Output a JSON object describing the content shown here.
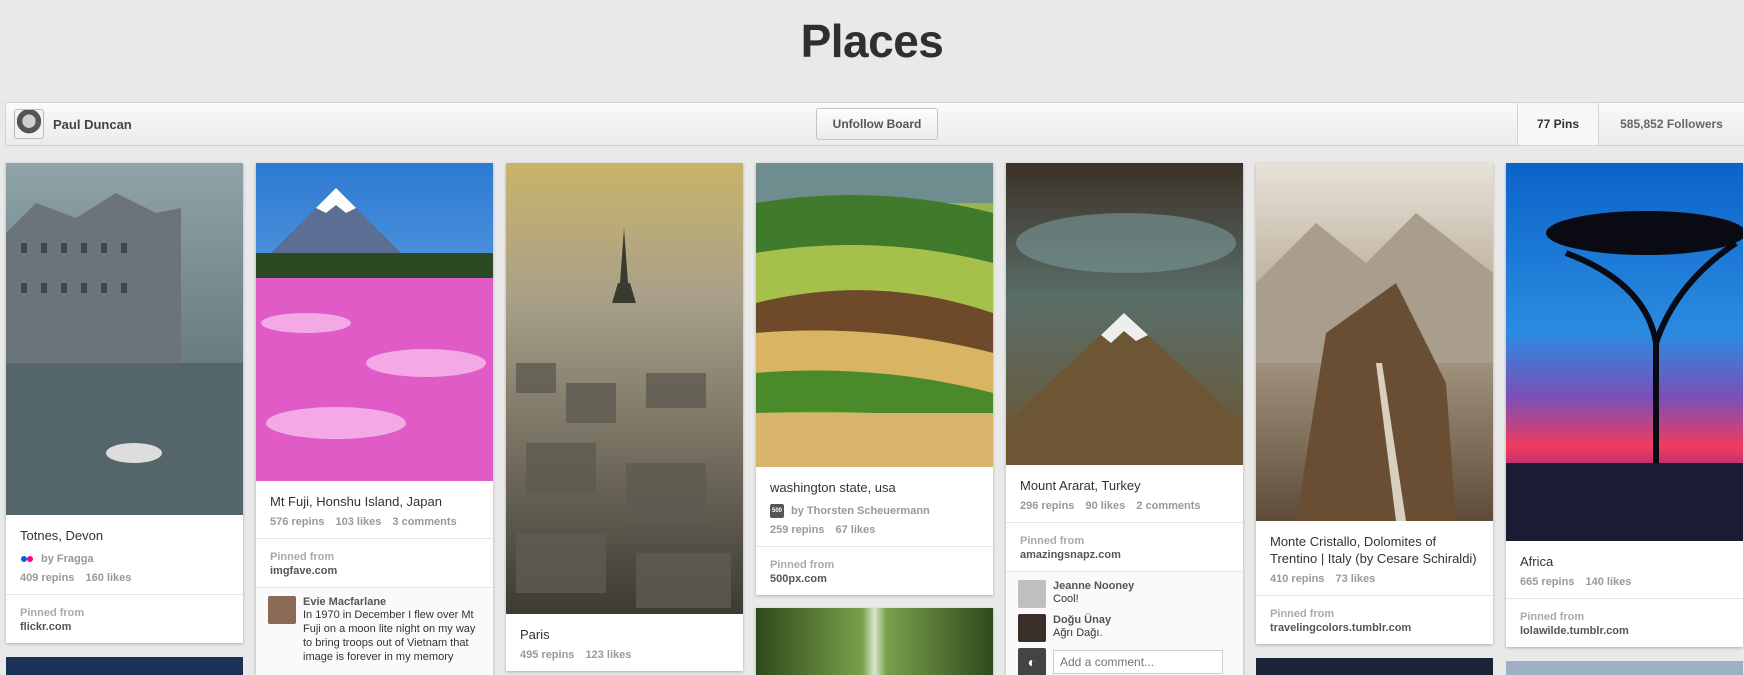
{
  "board": {
    "title": "Places",
    "owner_name": "Paul Duncan",
    "unfollow_label": "Unfollow Board",
    "pins_count": "77 Pins",
    "followers_count": "585,852 Followers"
  },
  "pins": [
    {
      "description": "Totnes, Devon",
      "by": "by Fragga",
      "repins": "409 repins",
      "likes": "160 likes",
      "source_label": "Pinned from",
      "source": "flickr.com"
    },
    {
      "description": "Mt Fuji, Honshu Island, Japan",
      "repins": "576 repins",
      "likes": "103 likes",
      "comments": "3 comments",
      "source_label": "Pinned from",
      "source": "imgfave.com",
      "comment": {
        "name": "Evie Macfarlane",
        "text": "In 1970 in December I flew over Mt Fuji on a moon lite night on my way to bring troops out of Vietnam that image is forever in my memory"
      }
    },
    {
      "description": "Paris",
      "repins": "495 repins",
      "likes": "123 likes"
    },
    {
      "description": "washington state, usa",
      "by": "by Thorsten Scheuermann",
      "repins": "259 repins",
      "likes": "67 likes",
      "source_label": "Pinned from",
      "source": "500px.com"
    },
    {
      "description": "Mount Ararat, Turkey",
      "repins": "296 repins",
      "likes": "90 likes",
      "comments": "2 comments",
      "source_label": "Pinned from",
      "source": "amazingsnapz.com",
      "comment_list": [
        {
          "name": "Jeanne Nooney",
          "text": "Cool!"
        },
        {
          "name": "Doğu Ünay",
          "text": "Ağrı Dağı."
        }
      ],
      "add_comment_placeholder": "Add a comment..."
    },
    {
      "description": "Monte Cristallo, Dolomites of Trentino | Italy (by Cesare Schiraldi)",
      "repins": "410 repins",
      "likes": "73 likes",
      "source_label": "Pinned from",
      "source": "travelingcolors.tumblr.com"
    },
    {
      "description": "Africa",
      "repins": "665 repins",
      "likes": "140 likes",
      "source_label": "Pinned from",
      "source": "lolawilde.tumblr.com"
    }
  ]
}
